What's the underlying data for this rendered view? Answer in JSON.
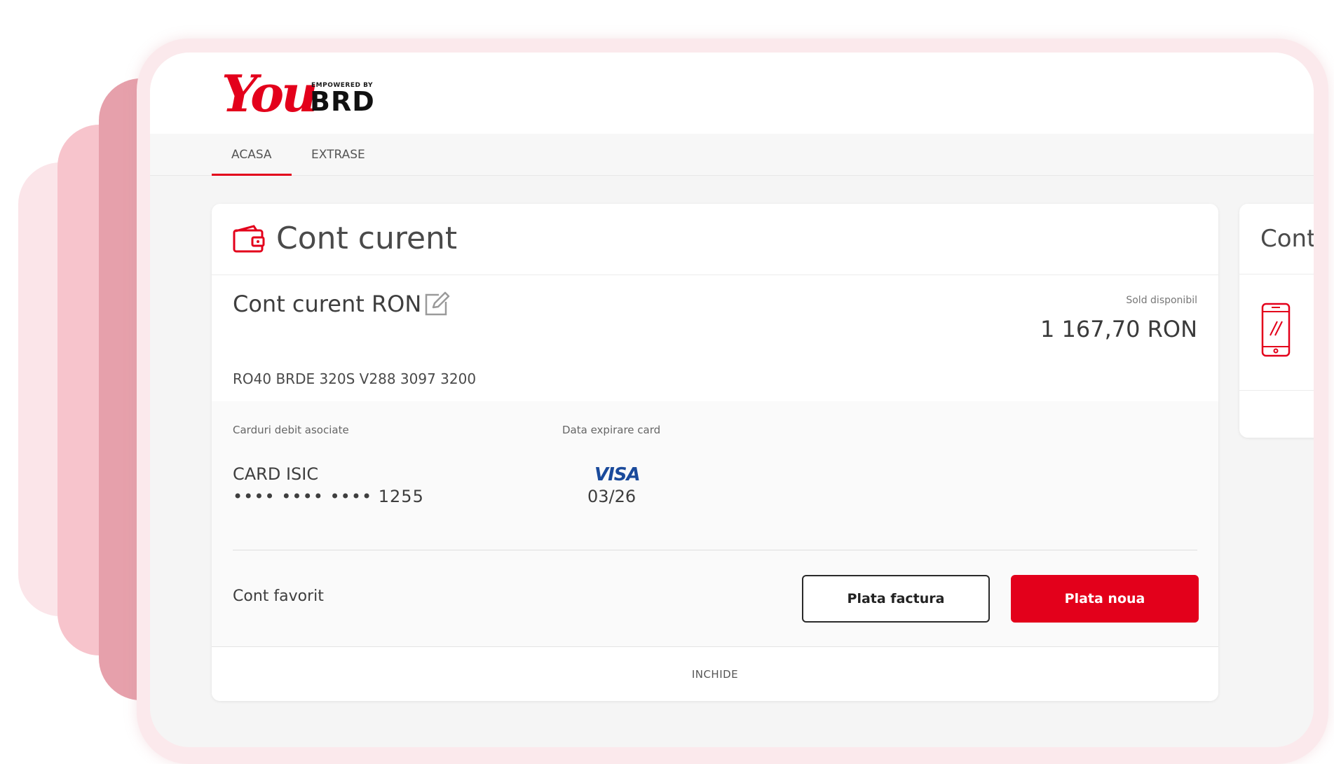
{
  "brand": {
    "logo_you": "You",
    "logo_powered": "EMPOWERED BY",
    "logo_brd": "BRD",
    "accent": "#e3001b"
  },
  "nav": {
    "tabs": [
      {
        "label": "ACASA",
        "active": true
      },
      {
        "label": "EXTRASE",
        "active": false
      }
    ]
  },
  "account_card": {
    "title": "Cont curent",
    "title_icon": "wallet-icon",
    "account_name": "Cont curent RON",
    "edit_icon": "edit-icon",
    "balance_label": "Sold disponibil",
    "balance_value": "1 167,70 RON",
    "iban": "RO40 BRDE 320S V288 3097 3200",
    "cards_label": "Carduri debit asociate",
    "expiry_label": "Data expirare card",
    "debit_card": {
      "name": "CARD ISIC",
      "number": "•••• •••• •••• 1255",
      "network": "VISA",
      "expiry": "03/26"
    },
    "favorite_label": "Cont favorit",
    "btn_bill": "Plata factura",
    "btn_new": "Plata noua",
    "close_label": "INCHIDE"
  },
  "second_card": {
    "title": "Cont",
    "icon": "phone-icon"
  }
}
